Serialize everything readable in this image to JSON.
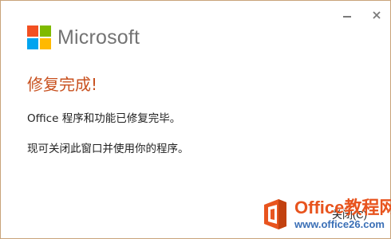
{
  "window": {
    "minimize_icon": "minimize-icon",
    "close_icon": "close-icon"
  },
  "brand": {
    "name": "Microsoft",
    "colors": {
      "red": "#f25022",
      "green": "#7fba00",
      "blue": "#00a4ef",
      "yellow": "#ffb900"
    }
  },
  "content": {
    "title": "修复完成!",
    "message_1": "Office 程序和功能已修复完毕。",
    "message_2": "现可关闭此窗口并使用你的程序。",
    "title_color": "#c8501e"
  },
  "footer": {
    "close_button_label": "关闭(C)"
  },
  "watermark": {
    "title": "Office教程网",
    "url": "www.office26.com"
  }
}
